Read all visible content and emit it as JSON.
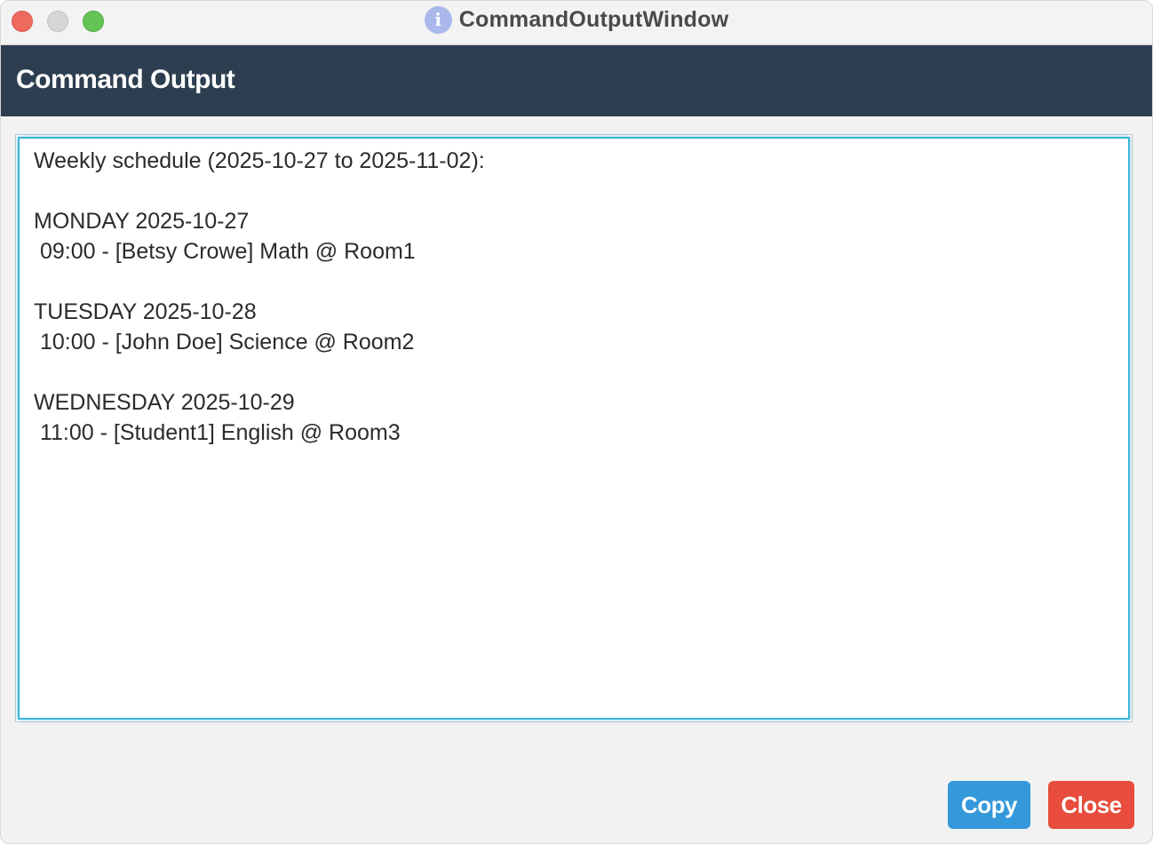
{
  "window": {
    "title": "CommandOutputWindow",
    "title_icon": "info-icon",
    "title_icon_glyph": "i",
    "controls": [
      "close",
      "minimize",
      "maximize"
    ]
  },
  "header": {
    "title": "Command Output"
  },
  "output": {
    "text": "Weekly schedule (2025-10-27 to 2025-11-02):\n\nMONDAY 2025-10-27\n 09:00 - [Betsy Crowe] Math @ Room1\n\nTUESDAY 2025-10-28\n 10:00 - [John Doe] Science @ Room2\n\nWEDNESDAY 2025-10-29\n 11:00 - [Student1] English @ Room3\n"
  },
  "buttons": {
    "copy_label": "Copy",
    "close_label": "Close"
  },
  "colors": {
    "header_bg": "#2c3e50",
    "copy_button": "#3498db",
    "close_button": "#e74c3c",
    "focus_border": "#3ab3d8"
  }
}
